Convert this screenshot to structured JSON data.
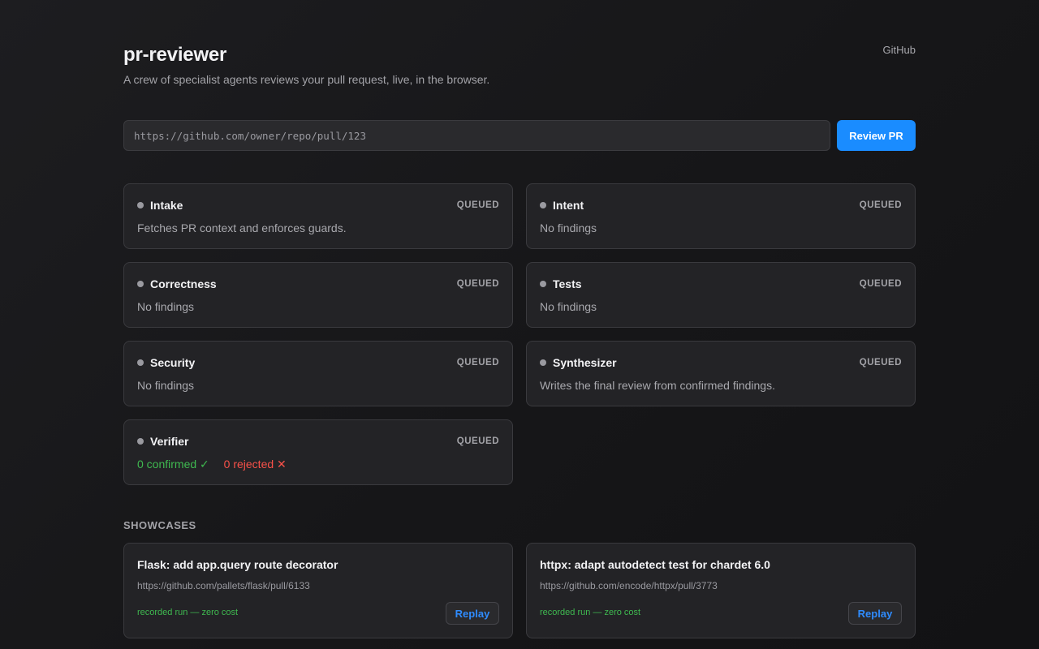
{
  "header": {
    "title": "pr-reviewer",
    "subtitle": "A crew of specialist agents reviews your pull request, live, in the browser.",
    "github_link": "GitHub"
  },
  "form": {
    "placeholder": "https://github.com/owner/repo/pull/123",
    "value": "",
    "submit_label": "Review PR"
  },
  "agents": [
    {
      "name": "Intake",
      "status": "QUEUED",
      "body": "Fetches PR context and enforces guards."
    },
    {
      "name": "Intent",
      "status": "QUEUED",
      "body": "No findings"
    },
    {
      "name": "Correctness",
      "status": "QUEUED",
      "body": "No findings"
    },
    {
      "name": "Tests",
      "status": "QUEUED",
      "body": "No findings"
    },
    {
      "name": "Security",
      "status": "QUEUED",
      "body": "No findings"
    },
    {
      "name": "Synthesizer",
      "status": "QUEUED",
      "body": "Writes the final review from confirmed findings."
    },
    {
      "name": "Verifier",
      "status": "QUEUED",
      "confirmed": "0 confirmed ✓",
      "rejected": "0 rejected ✕"
    }
  ],
  "showcases": {
    "title": "SHOWCASES",
    "items": [
      {
        "title": "Flask: add app.query route decorator",
        "url": "https://github.com/pallets/flask/pull/6133",
        "note": "recorded run — zero cost",
        "action": "Replay"
      },
      {
        "title": "httpx: adapt autodetect test for chardet 6.0",
        "url": "https://github.com/encode/httpx/pull/3773",
        "note": "recorded run — zero cost",
        "action": "Replay"
      }
    ]
  },
  "colors": {
    "accent": "#1a8cff",
    "success": "#3fb950",
    "danger": "#f85149",
    "status_dot": "#9a9aa0"
  }
}
